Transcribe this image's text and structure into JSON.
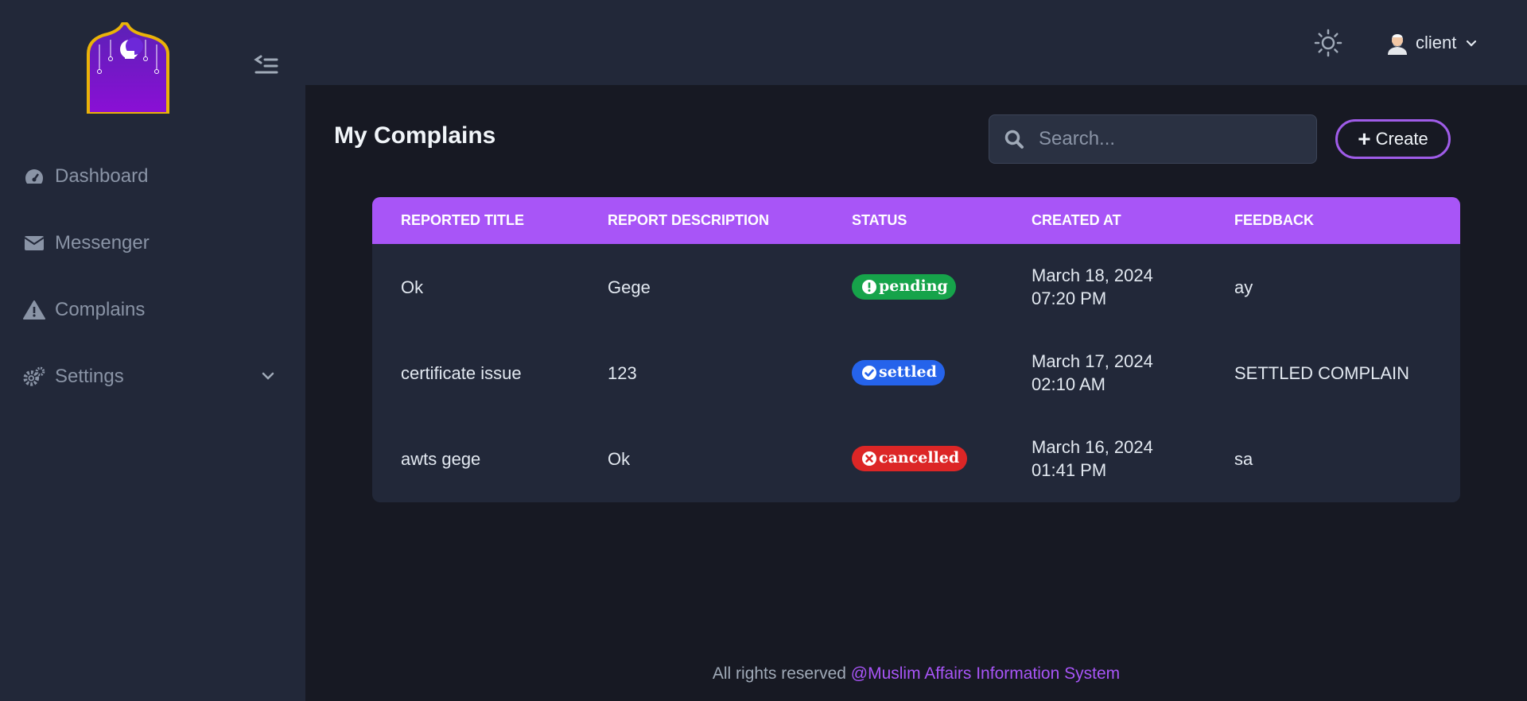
{
  "sidebar": {
    "items": [
      {
        "label": "Dashboard",
        "icon": "dashboard-gauge-icon"
      },
      {
        "label": "Messenger",
        "icon": "envelope-icon"
      },
      {
        "label": "Complains",
        "icon": "warning-triangle-icon"
      },
      {
        "label": "Settings",
        "icon": "gears-icon",
        "has_submenu": true
      }
    ]
  },
  "header": {
    "user_name": "client",
    "theme_icon": "sun-icon"
  },
  "main": {
    "title": "My Complains",
    "search_placeholder": "Search...",
    "create_label": "Create"
  },
  "table": {
    "headers": [
      "REPORTED TITLE",
      "REPORT DESCRIPTION",
      "STATUS",
      "CREATED AT",
      "FEEDBACK"
    ],
    "rows": [
      {
        "title": "Ok",
        "description": "Gege",
        "status": "pending",
        "created_date": "March 18, 2024",
        "created_time": "07:20 PM",
        "feedback": "ay"
      },
      {
        "title": "certificate issue",
        "description": "123",
        "status": "settled",
        "created_date": "March 17, 2024",
        "created_time": "02:10 AM",
        "feedback": "SETTLED COMPLAIN"
      },
      {
        "title": "awts gege",
        "description": "Ok",
        "status": "cancelled",
        "created_date": "March 16, 2024",
        "created_time": "01:41 PM",
        "feedback": "sa"
      }
    ]
  },
  "status_colors": {
    "pending": "#16a34a",
    "settled": "#2563eb",
    "cancelled": "#dc2626"
  },
  "footer": {
    "text": "All rights reserved",
    "brand": "@Muslim Affairs Information System"
  },
  "colors": {
    "accent": "#a855f7",
    "sidebar_bg": "#222839",
    "main_bg": "#171923"
  }
}
